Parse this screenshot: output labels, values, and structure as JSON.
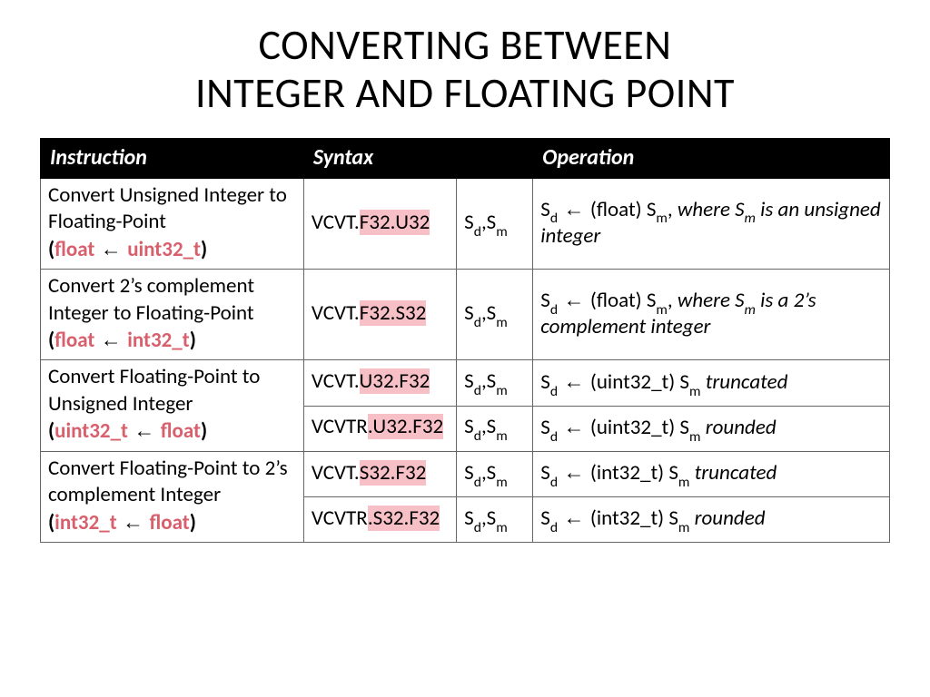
{
  "title_l1": "CONVERTING BETWEEN",
  "title_l2": "INTEGER AND FLOATING POINT",
  "headers": {
    "instruction": "Instruction",
    "syntax": "Syntax",
    "operation": "Operation"
  },
  "chart_data": {
    "type": "table",
    "title": "CONVERTING BETWEEN INTEGER AND FLOATING POINT",
    "columns": [
      "Instruction",
      "Syntax",
      "Operation"
    ],
    "rows": [
      {
        "instruction": "Convert Unsigned Integer to Floating-Point (float ← uint32_t)",
        "syntax": "VCVT.F32.U32 Sd,Sm",
        "operation": "Sd ← (float) Sm, where Sm is an unsigned integer"
      },
      {
        "instruction": "Convert 2's complement Integer to Floating-Point (float ← int32_t)",
        "syntax": "VCVT.F32.S32 Sd,Sm",
        "operation": "Sd ← (float) Sm, where Sm is a 2's complement integer"
      },
      {
        "instruction": "Convert Floating-Point to Unsigned Integer (uint32_t ← float)",
        "syntax": "VCVT.U32.F32 Sd,Sm",
        "operation": "Sd ← (uint32_t) Sm truncated"
      },
      {
        "instruction": "Convert Floating-Point to Unsigned Integer (uint32_t ← float)",
        "syntax": "VCVTR.U32.F32 Sd,Sm",
        "operation": "Sd ← (uint32_t) Sm rounded"
      },
      {
        "instruction": "Convert Floating-Point to 2's complement Integer (int32_t ← float)",
        "syntax": "VCVT.S32.F32 Sd,Sm",
        "operation": "Sd ← (int32_t) Sm truncated"
      },
      {
        "instruction": "Convert Floating-Point to 2's complement Integer (int32_t ← float)",
        "syntax": "VCVTR.S32.F32 Sd,Sm",
        "operation": "Sd ← (int32_t) Sm rounded"
      }
    ]
  },
  "rows": [
    {
      "desc_a": "Convert Unsigned Integer to Floating-Point",
      "desc_b_open": "(",
      "desc_b_lhs": "float",
      "desc_b_arrow": " ← ",
      "desc_b_rhs": "uint32_t",
      "desc_b_close": ")",
      "mnem_pre": "VCVT.",
      "mnem_hl": "F32.U32",
      "ops_pre": "S",
      "ops_sub1": "d",
      "ops_mid": ",S",
      "ops_sub2": "m",
      "op_pre": "S",
      "op_sub1": "d",
      "op_arrow": " ← ",
      "op_cast": "(float) S",
      "op_sub2": "m",
      "op_tail_plain": ", ",
      "op_tail_it_a": "where S",
      "op_tail_sub": "m",
      "op_tail_it_b": " is an unsigned integer",
      "op_suffix_italic": "",
      "op_cast2": ""
    },
    {
      "desc_a": "Convert 2’s complement Integer to Floating-Point",
      "desc_b_open": "(",
      "desc_b_lhs": "float",
      "desc_b_arrow": " ← ",
      "desc_b_rhs": "int32_t",
      "desc_b_close": ")",
      "mnem_pre": "VCVT.",
      "mnem_hl": "F32.S32",
      "ops_pre": "S",
      "ops_sub1": "d",
      "ops_mid": ",S",
      "ops_sub2": "m",
      "op_pre": "S",
      "op_sub1": "d",
      "op_arrow": " ← ",
      "op_cast": "(float) S",
      "op_sub2": "m",
      "op_tail_plain": ", ",
      "op_tail_it_a": "where S",
      "op_tail_sub": "m",
      "op_tail_it_b": " is a 2’s complement integer",
      "op_suffix_italic": "",
      "op_cast2": ""
    },
    {
      "desc_a": "Convert Floating-Point to Unsigned Integer",
      "desc_b_open": "(",
      "desc_b_lhs": "uint32_t",
      "desc_b_arrow": " ← ",
      "desc_b_rhs": "float",
      "desc_b_close": ")",
      "mnem_pre": "VCVT.",
      "mnem_hl": "U32.F32",
      "ops_pre": "S",
      "ops_sub1": "d",
      "ops_mid": ",S",
      "ops_sub2": "m",
      "op_pre": "S",
      "op_sub1": "d",
      "op_arrow": " ← ",
      "op_cast": "(uint32_t) S",
      "op_sub2": "m",
      "op_tail_plain": " ",
      "op_tail_it_a": "",
      "op_tail_sub": "",
      "op_tail_it_b": "",
      "op_suffix_italic": "truncated",
      "op_cast2": ""
    },
    {
      "desc_a": "",
      "desc_b_open": "",
      "desc_b_lhs": "",
      "desc_b_arrow": "",
      "desc_b_rhs": "",
      "desc_b_close": "",
      "mnem_pre": "VCVTR",
      "mnem_hl": ".U32.F32",
      "ops_pre": "S",
      "ops_sub1": "d",
      "ops_mid": ",S",
      "ops_sub2": "m",
      "op_pre": "S",
      "op_sub1": "d",
      "op_arrow": " ← ",
      "op_cast": "(uint32_t) S",
      "op_sub2": "m",
      "op_tail_plain": " ",
      "op_tail_it_a": "",
      "op_tail_sub": "",
      "op_tail_it_b": "",
      "op_suffix_italic": "rounded",
      "op_cast2": ""
    },
    {
      "desc_a": "Convert Floating-Point to 2’s complement Integer",
      "desc_b_open": "(",
      "desc_b_lhs": "int32_t",
      "desc_b_arrow": " ← ",
      "desc_b_rhs": "float",
      "desc_b_close": ")",
      "mnem_pre": "VCVT.",
      "mnem_hl": "S32.F32",
      "ops_pre": "S",
      "ops_sub1": "d",
      "ops_mid": ",S",
      "ops_sub2": "m",
      "op_pre": "S",
      "op_sub1": "d",
      "op_arrow": " ← ",
      "op_cast": "(int32_t) S",
      "op_sub2": "m",
      "op_tail_plain": " ",
      "op_tail_it_a": "",
      "op_tail_sub": "",
      "op_tail_it_b": "",
      "op_suffix_italic": "truncated",
      "op_cast2": ""
    },
    {
      "desc_a": "",
      "desc_b_open": "",
      "desc_b_lhs": "",
      "desc_b_arrow": "",
      "desc_b_rhs": "",
      "desc_b_close": "",
      "mnem_pre": "VCVTR",
      "mnem_hl": ".S32.F32",
      "ops_pre": "S",
      "ops_sub1": "d",
      "ops_mid": ",S",
      "ops_sub2": "m",
      "op_pre": "S",
      "op_sub1": "d",
      "op_arrow": " ← ",
      "op_cast": "(int32_t) S",
      "op_sub2": "m",
      "op_tail_plain": " ",
      "op_tail_it_a": "",
      "op_tail_sub": "",
      "op_tail_it_b": "",
      "op_suffix_italic": "rounded",
      "op_cast2": ""
    }
  ]
}
